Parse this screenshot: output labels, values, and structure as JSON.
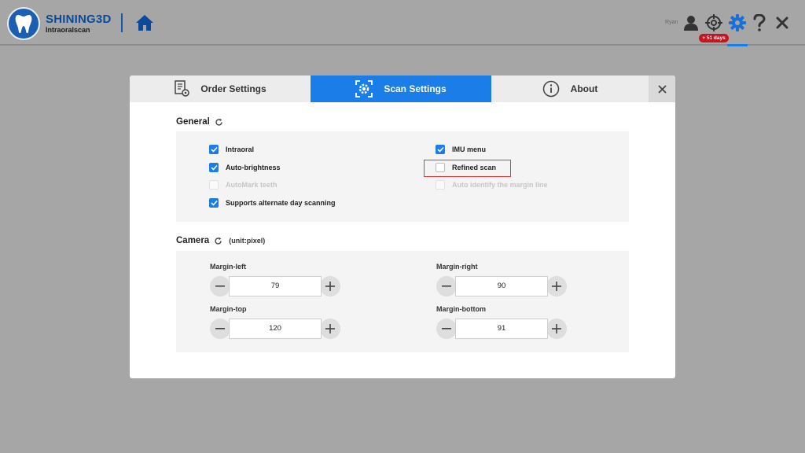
{
  "app": {
    "brand": "SHINING3D",
    "product": "Intraoralscan",
    "user": "Ryan",
    "trial_badge": "+ 51 days"
  },
  "dialog": {
    "tabs": [
      {
        "label": "Order Settings",
        "icon": "order-settings-icon",
        "active": false
      },
      {
        "label": "Scan Settings",
        "icon": "scan-settings-icon",
        "active": true
      },
      {
        "label": "About",
        "icon": "info-icon",
        "active": false
      }
    ],
    "general": {
      "title": "General",
      "options": [
        {
          "label": "Intraoral",
          "checked": true,
          "enabled": true
        },
        {
          "label": "IMU menu",
          "checked": true,
          "enabled": true
        },
        {
          "label": "Auto-brightness",
          "checked": true,
          "enabled": true
        },
        {
          "label": "Refined scan",
          "checked": false,
          "enabled": true
        },
        {
          "label": "AutoMark teeth",
          "checked": false,
          "enabled": false
        },
        {
          "label": "Auto identify the margin line",
          "checked": false,
          "enabled": false
        },
        {
          "label": "Supports alternate day scanning",
          "checked": true,
          "enabled": true
        }
      ]
    },
    "camera": {
      "title": "Camera",
      "unit": "(unit:pixel)",
      "fields": [
        {
          "label": "Margin-left",
          "value": "79"
        },
        {
          "label": "Margin-right",
          "value": "90"
        },
        {
          "label": "Margin-top",
          "value": "120"
        },
        {
          "label": "Margin-bottom",
          "value": "91"
        }
      ]
    }
  },
  "colors": {
    "accent": "#1a7de8",
    "brand": "#0b4a9a",
    "badge": "#c8141e",
    "highlight": "#e53935"
  }
}
